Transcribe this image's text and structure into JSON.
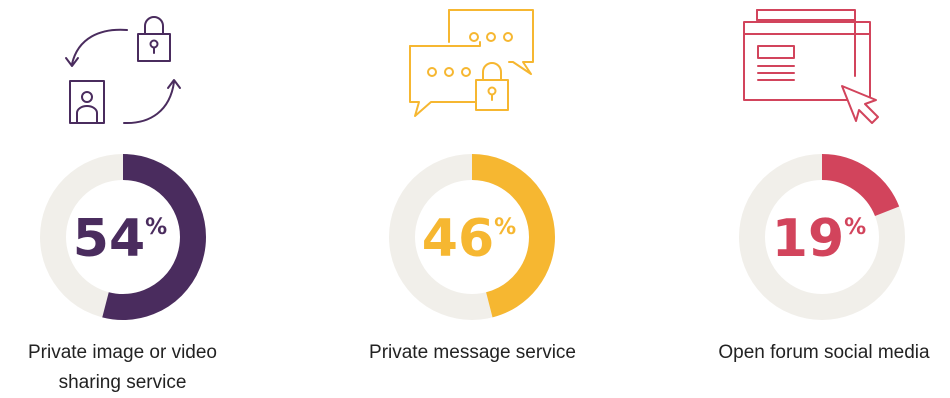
{
  "chart_data": {
    "type": "donut",
    "unit": "%",
    "colors": {
      "track": "#f1efea"
    },
    "items": [
      {
        "label": "Private image or video sharing service",
        "line1": "Private image or video",
        "line2": "sharing service",
        "value": 54,
        "color": "#4a2c5e",
        "icon": "lock-swap-icon"
      },
      {
        "label": "Private message service",
        "line1": "Private message service",
        "line2": "",
        "value": 46,
        "color": "#f6b731",
        "icon": "chat-lock-icon"
      },
      {
        "label": "Open forum social media",
        "line1": "Open forum social media",
        "line2": "",
        "value": 19,
        "color": "#d2445c",
        "icon": "browser-cursor-icon"
      }
    ]
  }
}
